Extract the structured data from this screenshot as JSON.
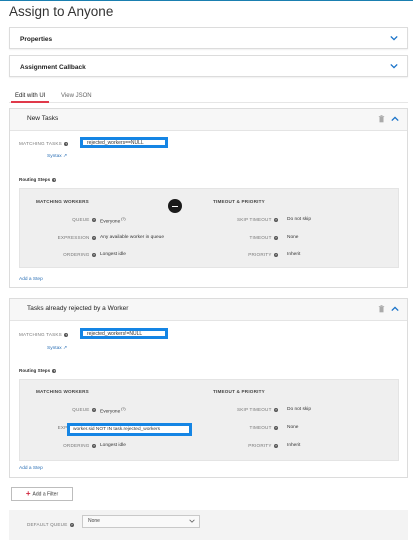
{
  "page": {
    "title": "Assign to Anyone"
  },
  "accordions": {
    "properties": "Properties",
    "assignment_callback": "Assignment Callback"
  },
  "tabs": {
    "edit_ui": "Edit with UI",
    "view_json": "View JSON"
  },
  "filters": [
    {
      "title": "New Tasks",
      "matching_tasks_label": "MATCHING TASKS",
      "matching_tasks_value": "rejected_workers==NULL",
      "syntax_link": "Syntax ↗",
      "routing_steps_label": "Routing Steps",
      "headers": {
        "matching_workers": "MATCHING WORKERS",
        "timeout_priority": "TIMEOUT & PRIORITY"
      },
      "rows": {
        "queue": {
          "label": "QUEUE",
          "value": "Everyone"
        },
        "expression": {
          "label": "EXPRESSION",
          "value": "Any available worker in queue"
        },
        "ordering": {
          "label": "ORDERING",
          "value": "Longest idle"
        },
        "skip_timeout": {
          "label": "SKIP TIMEOUT",
          "value": "Do not skip"
        },
        "timeout": {
          "label": "TIMEOUT",
          "value": "None"
        },
        "priority": {
          "label": "PRIORITY",
          "value": "Inherit"
        }
      },
      "add_step": "Add a Step"
    },
    {
      "title": "Tasks already rejected by a Worker",
      "matching_tasks_label": "MATCHING TASKS",
      "matching_tasks_value": "rejected_workers!=NULL",
      "syntax_link": "Syntax ↗",
      "routing_steps_label": "Routing Steps",
      "headers": {
        "matching_workers": "MATCHING WORKERS",
        "timeout_priority": "TIMEOUT & PRIORITY"
      },
      "rows": {
        "queue": {
          "label": "QUEUE",
          "value": "Everyone"
        },
        "expression": {
          "label": "EXPRESSION",
          "value": "worker.sid NOT IN task.rejected_workers"
        },
        "ordering": {
          "label": "ORDERING",
          "value": "Longest idle"
        },
        "skip_timeout": {
          "label": "SKIP TIMEOUT",
          "value": "Do not skip"
        },
        "timeout": {
          "label": "TIMEOUT",
          "value": "None"
        },
        "priority": {
          "label": "PRIORITY",
          "value": "Inherit"
        }
      },
      "add_step": "Add a Step"
    }
  ],
  "add_filter": "Add a Filter",
  "default_queue": {
    "label": "DEFAULT QUEUE",
    "value": "None"
  },
  "icons": {
    "chevron": "chevron-down-icon",
    "trash": "trash-icon",
    "collapse": "chevron-up-icon",
    "help": "help-icon",
    "zoom_out": "zoom-out-icon"
  },
  "colors": {
    "highlight": "#1585e4",
    "link": "#2a6fb5",
    "accent_red": "#e0394a"
  }
}
